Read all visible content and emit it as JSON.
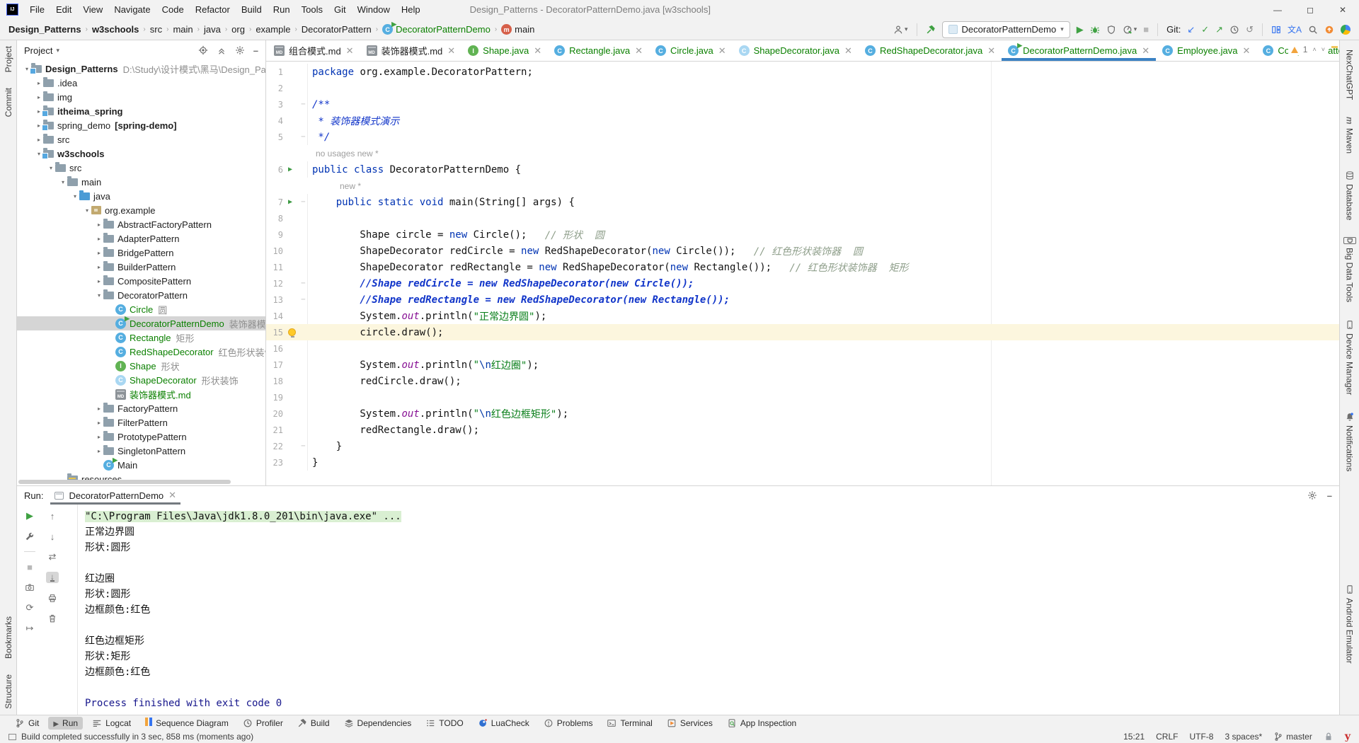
{
  "titlebar": {
    "title": "Design_Patterns - DecoratorPatternDemo.java [w3schools]",
    "menus": [
      "File",
      "Edit",
      "View",
      "Navigate",
      "Code",
      "Refactor",
      "Build",
      "Run",
      "Tools",
      "Git",
      "Window",
      "Help"
    ],
    "controls": [
      "minimize",
      "maximize",
      "close"
    ]
  },
  "breadcrumbs": [
    {
      "label": "Design_Patterns",
      "bold": true
    },
    {
      "label": "w3schools",
      "bold": true
    },
    {
      "label": "src"
    },
    {
      "label": "main"
    },
    {
      "label": "java"
    },
    {
      "label": "org"
    },
    {
      "label": "example"
    },
    {
      "label": "DecoratorPattern"
    },
    {
      "label": "DecoratorPatternDemo",
      "green": true,
      "icon": "runclass"
    },
    {
      "label": "main",
      "icon": "method"
    }
  ],
  "toolbar": {
    "run_config": "DecoratorPatternDemo",
    "git_label": "Git:"
  },
  "left_strip": {
    "top": [
      "Project",
      "Commit"
    ],
    "bottom": [
      "Bookmarks",
      "Structure"
    ]
  },
  "right_strip": {
    "top": [
      "NexChatGPT",
      "Maven",
      "Database",
      "Big Data Tools",
      "Device Manager",
      "Notifications"
    ],
    "bottom": [
      "Android Emulator"
    ]
  },
  "project_panel": {
    "header": "Project",
    "tree": [
      {
        "lvl": 0,
        "arrow": "v",
        "icon": "folder-mod",
        "label": "Design_Patterns",
        "bold": true,
        "ann": "D:\\Study\\设计模式\\黑马\\Design_Patte"
      },
      {
        "lvl": 1,
        "arrow": ">",
        "icon": "folder",
        "label": ".idea"
      },
      {
        "lvl": 1,
        "arrow": ">",
        "icon": "folder",
        "label": "img"
      },
      {
        "lvl": 1,
        "arrow": ">",
        "icon": "folder-mod",
        "label": "itheima_spring",
        "bold": true
      },
      {
        "lvl": 1,
        "arrow": ">",
        "icon": "folder-mod",
        "label": "spring_demo",
        "extra": "[spring-demo]"
      },
      {
        "lvl": 1,
        "arrow": ">",
        "icon": "folder",
        "label": "src"
      },
      {
        "lvl": 1,
        "arrow": "v",
        "icon": "folder-mod",
        "label": "w3schools",
        "bold": true
      },
      {
        "lvl": 2,
        "arrow": "v",
        "icon": "folder",
        "label": "src"
      },
      {
        "lvl": 3,
        "arrow": "v",
        "icon": "folder",
        "label": "main"
      },
      {
        "lvl": 4,
        "arrow": "v",
        "icon": "folder-src",
        "label": "java"
      },
      {
        "lvl": 5,
        "arrow": "v",
        "icon": "package",
        "label": "org.example"
      },
      {
        "lvl": 6,
        "arrow": ">",
        "icon": "folder",
        "label": "AbstractFactoryPattern"
      },
      {
        "lvl": 6,
        "arrow": ">",
        "icon": "folder",
        "label": "AdapterPattern"
      },
      {
        "lvl": 6,
        "arrow": ">",
        "icon": "folder",
        "label": "BridgePattern"
      },
      {
        "lvl": 6,
        "arrow": ">",
        "icon": "folder",
        "label": "BuilderPattern"
      },
      {
        "lvl": 6,
        "arrow": ">",
        "icon": "folder",
        "label": "CompositePattern"
      },
      {
        "lvl": 6,
        "arrow": "v",
        "icon": "folder",
        "label": "DecoratorPattern"
      },
      {
        "lvl": 7,
        "icon": "class",
        "label": "Circle",
        "green": true,
        "ann": "圆"
      },
      {
        "lvl": 7,
        "icon": "runclass",
        "label": "DecoratorPatternDemo",
        "green": true,
        "ann": "装饰器模式演示",
        "selected": true
      },
      {
        "lvl": 7,
        "icon": "class",
        "label": "Rectangle",
        "green": true,
        "ann": "矩形"
      },
      {
        "lvl": 7,
        "icon": "class",
        "label": "RedShapeDecorator",
        "green": true,
        "ann": "红色形状装饰器"
      },
      {
        "lvl": 7,
        "icon": "interface",
        "label": "Shape",
        "green": true,
        "ann": "形状"
      },
      {
        "lvl": 7,
        "icon": "abstract",
        "label": "ShapeDecorator",
        "green": true,
        "ann": "形状装饰"
      },
      {
        "lvl": 7,
        "icon": "md",
        "label": "装饰器模式.md",
        "green": true
      },
      {
        "lvl": 6,
        "arrow": ">",
        "icon": "folder",
        "label": "FactoryPattern"
      },
      {
        "lvl": 6,
        "arrow": ">",
        "icon": "folder",
        "label": "FilterPattern"
      },
      {
        "lvl": 6,
        "arrow": ">",
        "icon": "folder",
        "label": "PrototypePattern"
      },
      {
        "lvl": 6,
        "arrow": ">",
        "icon": "folder",
        "label": "SingletonPattern"
      },
      {
        "lvl": 6,
        "icon": "runclass",
        "label": "Main"
      },
      {
        "lvl": 3,
        "icon": "folder-res",
        "label": "resources"
      }
    ]
  },
  "editor": {
    "tabs": [
      {
        "icon": "md",
        "label": "组合模式.md"
      },
      {
        "icon": "md",
        "label": "装饰器模式.md"
      },
      {
        "icon": "interface",
        "label": "Shape.java",
        "green": true
      },
      {
        "icon": "class",
        "label": "Rectangle.java",
        "green": true
      },
      {
        "icon": "class",
        "label": "Circle.java",
        "green": true
      },
      {
        "icon": "abstract",
        "label": "ShapeDecorator.java",
        "green": true
      },
      {
        "icon": "class",
        "label": "RedShapeDecorator.java",
        "green": true
      },
      {
        "icon": "runclass",
        "label": "DecoratorPatternDemo.java",
        "green": true,
        "selected": true
      },
      {
        "icon": "class",
        "label": "Employee.java",
        "green": true
      },
      {
        "icon": "class",
        "label": "CompositePatternDe",
        "green": true
      }
    ],
    "inspection": {
      "warning_count": "1"
    },
    "rows": [
      {
        "num": "1",
        "segs": [
          [
            "k",
            "package"
          ],
          [
            "p",
            " org.example.DecoratorPattern;"
          ]
        ]
      },
      {
        "num": "2",
        "segs": []
      },
      {
        "num": "3",
        "fold": "-",
        "segs": [
          [
            "d",
            "/**"
          ]
        ]
      },
      {
        "num": "4",
        "segs": [
          [
            "d",
            " * 装饰器模式演示"
          ]
        ]
      },
      {
        "num": "5",
        "fold": "-",
        "segs": [
          [
            "d",
            " */"
          ]
        ]
      },
      {
        "hint": "no usages   new *",
        "pad": 70
      },
      {
        "num": "6",
        "run": true,
        "segs": [
          [
            "k",
            "public class"
          ],
          [
            "p",
            " DecoratorPatternDemo {"
          ]
        ]
      },
      {
        "hint": "new *",
        "pad": 104
      },
      {
        "num": "7",
        "run": true,
        "fold": "-",
        "segs": [
          [
            "p",
            "    "
          ],
          [
            "k",
            "public static void"
          ],
          [
            "p",
            " main(String[] args) {"
          ]
        ]
      },
      {
        "num": "8",
        "segs": []
      },
      {
        "num": "9",
        "segs": [
          [
            "p",
            "        Shape circle = "
          ],
          [
            "k",
            "new"
          ],
          [
            "p",
            " Circle();   "
          ],
          [
            "cm",
            "// 形状  圆"
          ]
        ]
      },
      {
        "num": "10",
        "segs": [
          [
            "p",
            "        ShapeDecorator redCircle = "
          ],
          [
            "k",
            "new"
          ],
          [
            "p",
            " RedShapeDecorator("
          ],
          [
            "k",
            "new"
          ],
          [
            "p",
            " Circle());   "
          ],
          [
            "cm",
            "// 红色形状装饰器  圆"
          ]
        ]
      },
      {
        "num": "11",
        "segs": [
          [
            "p",
            "        ShapeDecorator redRectangle = "
          ],
          [
            "k",
            "new"
          ],
          [
            "p",
            " RedShapeDecorator("
          ],
          [
            "k",
            "new"
          ],
          [
            "p",
            " Rectangle());   "
          ],
          [
            "cm",
            "// 红色形状装饰器  矩形"
          ]
        ]
      },
      {
        "num": "12",
        "fold": "-",
        "segs": [
          [
            "xx",
            "        //Shape redCircle = new RedShapeDecorator(new Circle());"
          ]
        ]
      },
      {
        "num": "13",
        "fold": "-",
        "segs": [
          [
            "xx",
            "        //Shape redRectangle = new RedShapeDecorator(new Rectangle());"
          ]
        ]
      },
      {
        "num": "14",
        "segs": [
          [
            "p",
            "        System."
          ],
          [
            "f",
            "out"
          ],
          [
            "p",
            ".println("
          ],
          [
            "s",
            "\"正常边界圆\""
          ],
          [
            "p",
            ");"
          ]
        ]
      },
      {
        "num": "15",
        "bulb": true,
        "hl": true,
        "segs": [
          [
            "p",
            "        circle.draw();"
          ]
        ]
      },
      {
        "num": "16",
        "segs": []
      },
      {
        "num": "17",
        "segs": [
          [
            "p",
            "        System."
          ],
          [
            "f",
            "out"
          ],
          [
            "p",
            ".println("
          ],
          [
            "s",
            "\""
          ],
          [
            "e",
            "\\n"
          ],
          [
            "s",
            "红边圈\""
          ],
          [
            "p",
            ");"
          ]
        ]
      },
      {
        "num": "18",
        "segs": [
          [
            "p",
            "        redCircle.draw();"
          ]
        ]
      },
      {
        "num": "19",
        "segs": []
      },
      {
        "num": "20",
        "segs": [
          [
            "p",
            "        System."
          ],
          [
            "f",
            "out"
          ],
          [
            "p",
            ".println("
          ],
          [
            "s",
            "\""
          ],
          [
            "e",
            "\\n"
          ],
          [
            "s",
            "红色边框矩形\""
          ],
          [
            "p",
            ");"
          ]
        ]
      },
      {
        "num": "21",
        "segs": [
          [
            "p",
            "        redRectangle.draw();"
          ]
        ]
      },
      {
        "num": "22",
        "fold": "-",
        "segs": [
          [
            "p",
            "    }"
          ]
        ]
      },
      {
        "num": "23",
        "segs": [
          [
            "p",
            "}"
          ]
        ]
      }
    ]
  },
  "run_panel": {
    "label": "Run:",
    "tab": "DecoratorPatternDemo",
    "console": [
      {
        "text": "\"C:\\Program Files\\Java\\jdk1.8.0_201\\bin\\java.exe\" ...",
        "style": "cmd"
      },
      {
        "text": "正常边界圆"
      },
      {
        "text": "形状:圆形"
      },
      {
        "text": ""
      },
      {
        "text": "红边圈"
      },
      {
        "text": "形状:圆形"
      },
      {
        "text": "边框颜色:红色"
      },
      {
        "text": ""
      },
      {
        "text": "红色边框矩形"
      },
      {
        "text": "形状:矩形"
      },
      {
        "text": "边框颜色:红色"
      },
      {
        "text": ""
      },
      {
        "text": "Process finished with exit code 0",
        "style": "exit"
      }
    ]
  },
  "bottom_bar": {
    "items": [
      {
        "label": "Git",
        "icon": "branch"
      },
      {
        "label": "Run",
        "icon": "play",
        "active": true
      },
      {
        "label": "Logcat",
        "icon": "logcat"
      },
      {
        "label": "Sequence Diagram",
        "icon": "seq"
      },
      {
        "label": "Profiler",
        "icon": "clock"
      },
      {
        "label": "Build",
        "icon": "hammer-sm"
      },
      {
        "label": "Dependencies",
        "icon": "layers"
      },
      {
        "label": "TODO",
        "icon": "todo"
      },
      {
        "label": "LuaCheck",
        "icon": "lua"
      },
      {
        "label": "Problems",
        "icon": "problem"
      },
      {
        "label": "Terminal",
        "icon": "terminal"
      },
      {
        "label": "Services",
        "icon": "services"
      },
      {
        "label": "App Inspection",
        "icon": "appinsp"
      }
    ]
  },
  "status_bar": {
    "message": "Build completed successfully in 3 sec, 858 ms (moments ago)",
    "time": "15:21",
    "line_ending": "CRLF",
    "encoding": "UTF-8",
    "indent": "3 spaces*",
    "branch": "master"
  }
}
